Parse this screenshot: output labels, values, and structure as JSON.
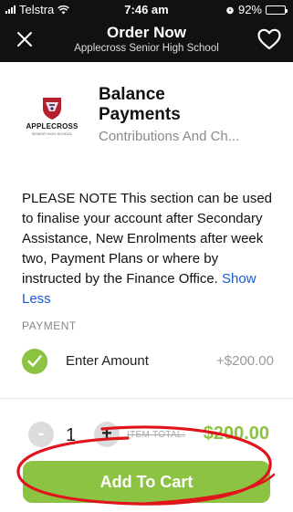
{
  "status_bar": {
    "carrier": "Telstra",
    "time": "7:46 am",
    "battery": "92%",
    "battery_level": 0.92
  },
  "nav": {
    "title": "Order Now",
    "subtitle": "Applecross Senior High School",
    "left_icon": "close-icon",
    "right_icon": "heart-icon"
  },
  "product": {
    "logo_name": "APPLECROSS",
    "logo_sub": "SENIOR HIGH SCHOOL",
    "name": "Balance Payments",
    "category": "Contributions And Ch..."
  },
  "description": {
    "text": "PLEASE NOTE  This section can be used to finalise your account after Secondary Assistance, New Enrolments after week two, Payment Plans or where by instructed by the Finance Office.",
    "toggle_label": "Show Less"
  },
  "payment": {
    "section_label": "PAYMENT",
    "option_label": "Enter Amount",
    "option_price": "+$200.00",
    "selected": true
  },
  "cart": {
    "minus": "-",
    "plus": "+",
    "quantity": "1",
    "item_total_label": "ITEM TOTAL:",
    "item_total": "$200.00",
    "add_label": "Add To Cart"
  },
  "colors": {
    "accent_green": "#8cc343",
    "link_blue": "#1a5ad6",
    "annotation_red": "#e0141b"
  }
}
